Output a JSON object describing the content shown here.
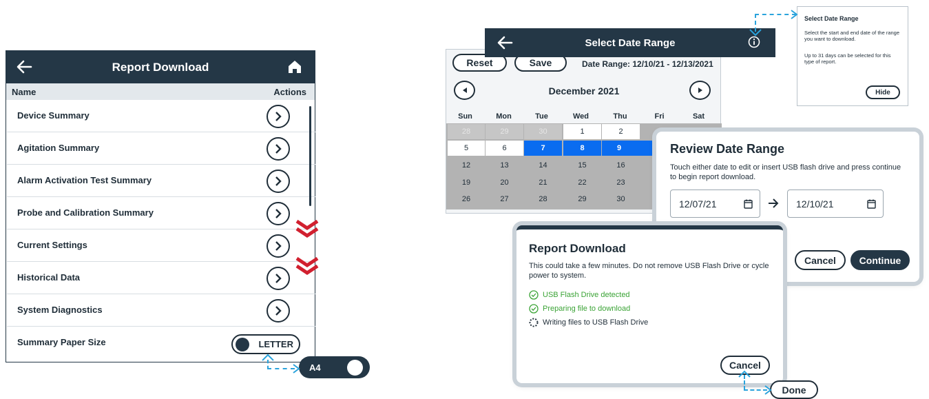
{
  "report_download": {
    "title": "Report Download",
    "col_name": "Name",
    "col_actions": "Actions",
    "items": [
      "Device Summary",
      "Agitation Summary",
      "Alarm Activation Test Summary",
      "Probe and Calibration Summary",
      "Current Settings",
      "Historical Data",
      "System Diagnostics"
    ],
    "paper_size_label": "Summary Paper Size",
    "paper_toggle_value": "LETTER",
    "paper_toggle_alt": "A4"
  },
  "select_date_range": {
    "title": "Select Date Range",
    "reset_label": "Reset",
    "save_label": "Save",
    "date_range_text": "Date Range: 12/10/21 - 12/13/2021",
    "month_label": "December 2021",
    "weekdays": [
      "Sun",
      "Mon",
      "Tue",
      "Wed",
      "Thu",
      "Fri",
      "Sat"
    ],
    "row1": [
      "28",
      "29",
      "30",
      "1",
      "2"
    ],
    "row2": [
      "5",
      "6",
      "7",
      "8",
      "9"
    ],
    "row3": [
      "12",
      "13",
      "14",
      "15",
      "16"
    ],
    "row4": [
      "19",
      "20",
      "21",
      "22",
      "23"
    ],
    "row5": [
      "26",
      "27",
      "28",
      "29",
      "30"
    ]
  },
  "info_popup": {
    "title": "Select Date Range",
    "text1": "Select the start and end date of the range you want to download.",
    "text2": "Up to 31 days can be selected for this type of report.",
    "hide_label": "Hide"
  },
  "review_dialog": {
    "title": "Review Date Range",
    "text": "Touch either date to edit or insert USB flash drive and press continue to begin report download.",
    "start_date": "12/07/21",
    "end_date": "12/10/21",
    "cancel_label": "Cancel",
    "continue_label": "Continue"
  },
  "download_dialog": {
    "title": "Report Download",
    "text": "This could take a few minutes. Do not remove USB Flash Drive or cycle power to system.",
    "status1": "USB Flash Drive detected",
    "status2": "Preparing file to download",
    "status3": "Writing files to USB Flash Drive",
    "cancel_label": "Cancel",
    "done_label": "Done"
  },
  "colors": {
    "header": "#243746",
    "selected_day": "#0a6cf0",
    "success": "#3aa335",
    "scroll_arrows": "#d1202f",
    "annotation": "#2aa3dc"
  }
}
